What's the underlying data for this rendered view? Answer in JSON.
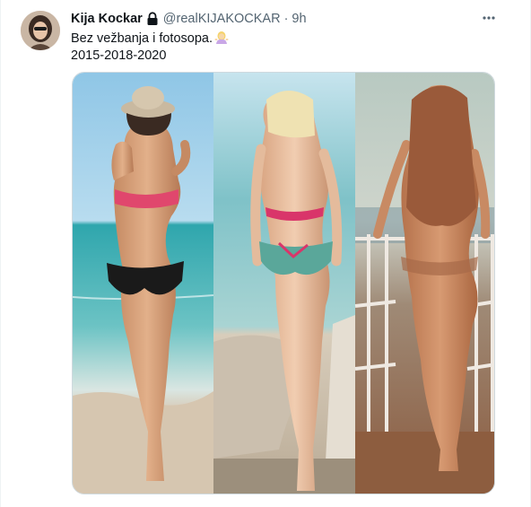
{
  "tweet": {
    "display_name": "Kija Kockar",
    "handle": "@realKIJAKOCKAR",
    "separator": "·",
    "time": "9h",
    "text_line1": "Bez vežbanja i fotosopa.",
    "text_line2": "2015-2018-2020",
    "emoji_name": "woman-shrugging-emoji",
    "verified_icon": "lock-icon",
    "more_icon": "more-dots-icon"
  },
  "colors": {
    "text_primary": "#0f1419",
    "text_secondary": "#536471",
    "border": "#cfd9de"
  },
  "media": {
    "panels": [
      "beach-photo-2015",
      "shower-photo-2018",
      "balcony-photo-2020"
    ]
  }
}
